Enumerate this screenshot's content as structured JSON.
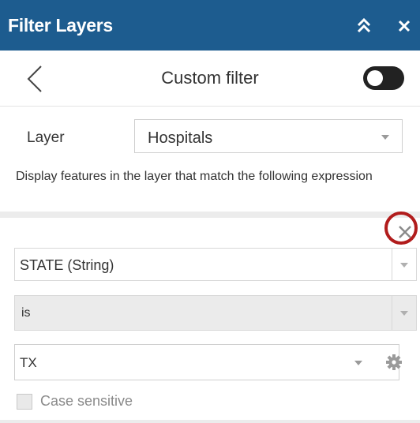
{
  "header": {
    "title": "Filter Layers",
    "collapse_icon": "double-chevron-up-icon",
    "close_icon": "close-icon",
    "background": "#1d5c8f"
  },
  "subheader": {
    "back_icon": "chevron-left-icon",
    "title": "Custom filter",
    "toggle_on": false
  },
  "layer": {
    "label": "Layer",
    "selected": "Hospitals"
  },
  "description": "Display features in the layer that match the following expression",
  "expression": {
    "remove_icon": "close-icon",
    "highlight_color": "#b11c1c",
    "field": "STATE (String)",
    "operator": "is",
    "value": "TX",
    "settings_icon": "gear-icon",
    "case_sensitive": {
      "label": "Case sensitive",
      "checked": false
    }
  }
}
